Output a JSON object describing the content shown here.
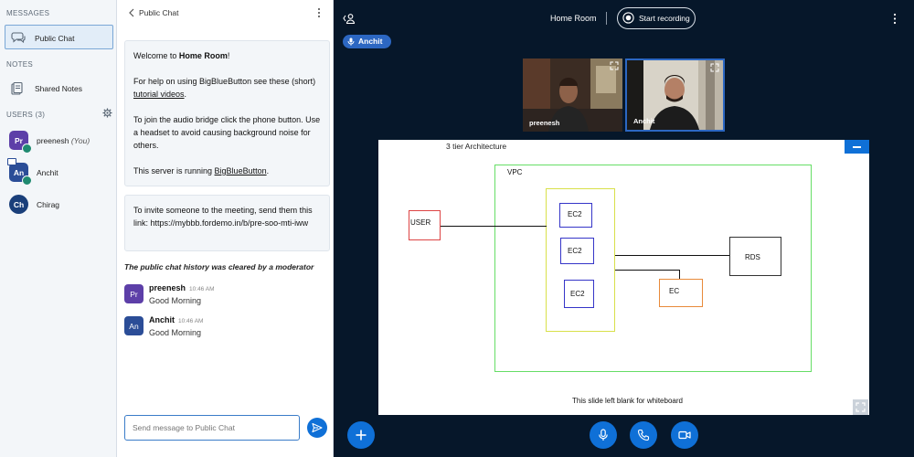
{
  "sidebar": {
    "messages_title": "MESSAGES",
    "public_chat_label": "Public Chat",
    "notes_title": "NOTES",
    "shared_notes_label": "Shared Notes",
    "users_title": "USERS (3)",
    "users": [
      {
        "initials": "Pr",
        "name": "preenesh",
        "suffix": "(You)",
        "color": "#5d3fa8"
      },
      {
        "initials": "An",
        "name": "Anchit",
        "suffix": "",
        "color": "#2b4d97"
      },
      {
        "initials": "Ch",
        "name": "Chirag",
        "suffix": "",
        "color": "#1a3f7a"
      }
    ]
  },
  "chat": {
    "header_title": "Public Chat",
    "welcome": {
      "line1_prefix": "Welcome to ",
      "room_name": "Home Room",
      "line1_suffix": "!",
      "help_text": "For help on using BigBlueButton see these (short) ",
      "help_link": "tutorial videos",
      "help_end": ".",
      "audio_text": "To join the audio bridge click the phone button. Use a headset to avoid causing background noise for others.",
      "server_text": "This server is running ",
      "server_link": "BigBlueButton",
      "server_end": "."
    },
    "invite_text": "To invite someone to the meeting, send them this link: https://mybbb.fordemo.in/b/pre-soo-mti-iww",
    "cleared_notice": "The public chat history was cleared by a moderator",
    "messages": [
      {
        "initials": "Pr",
        "name": "preenesh",
        "time": "10:46 AM",
        "text": "Good Morning",
        "color": "#5d3fa8"
      },
      {
        "initials": "An",
        "name": "Anchit",
        "time": "10:46 AM",
        "text": "Good Morning",
        "color": "#2b4d97"
      }
    ],
    "input_placeholder": "Send message to Public Chat"
  },
  "main": {
    "room_title": "Home Room",
    "record_label": "Start recording",
    "talker_name": "Anchit",
    "videos": [
      {
        "name": "preenesh"
      },
      {
        "name": "Anchit"
      }
    ]
  },
  "slide": {
    "title": "3 tier Architecture",
    "footer": "This slide left blank for whiteboard",
    "diagram": {
      "vpc": "VPC",
      "user": "USER",
      "ec2_a": "EC2",
      "ec2_b": "EC2",
      "ec2_c": "EC2",
      "ec": "EC",
      "rds": "RDS"
    }
  },
  "colors": {
    "accent": "#0f70d7",
    "dark_bg": "#06172a",
    "talking_indicator": "#1f8a70"
  },
  "icons": {
    "bottom_actions": [
      "plus-icon",
      "microphone-icon",
      "phone-icon",
      "video-camera-icon"
    ]
  }
}
